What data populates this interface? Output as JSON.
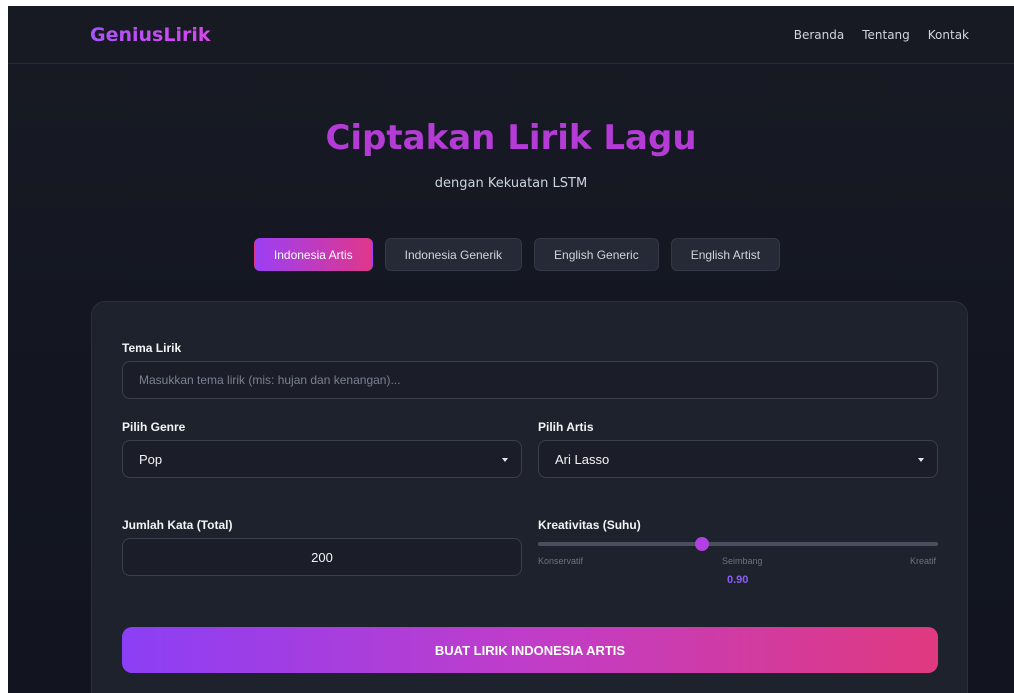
{
  "nav": {
    "logo": "GeniusLirik",
    "links": [
      "Beranda",
      "Tentang",
      "Kontak"
    ]
  },
  "hero": {
    "title": "Ciptakan Lirik Lagu",
    "subtitle": "dengan Kekuatan LSTM"
  },
  "tabs": [
    {
      "label": "Indonesia Artis",
      "active": true
    },
    {
      "label": "Indonesia Generik",
      "active": false
    },
    {
      "label": "English Generic",
      "active": false
    },
    {
      "label": "English Artist",
      "active": false
    }
  ],
  "form": {
    "theme": {
      "label": "Tema Lirik",
      "placeholder": "Masukkan tema lirik (mis: hujan dan kenangan)...",
      "value": ""
    },
    "genre": {
      "label": "Pilih Genre",
      "value": "Pop"
    },
    "artist": {
      "label": "Pilih Artis",
      "value": "Ari Lasso"
    },
    "word_count": {
      "label": "Jumlah Kata (Total)",
      "value": "200"
    },
    "creativity": {
      "label": "Kreativitas (Suhu)",
      "min_label": "Konservatif",
      "mid_label": "Seimbang",
      "max_label": "Kreatif",
      "value": "0.90",
      "position_fraction": 0.41
    },
    "submit_label": "BUAT LIRIK INDONESIA ARTIS"
  },
  "colors": {
    "accent_purple": "#9c3ff5",
    "accent_pink": "#e0378a",
    "background": "#131621"
  }
}
